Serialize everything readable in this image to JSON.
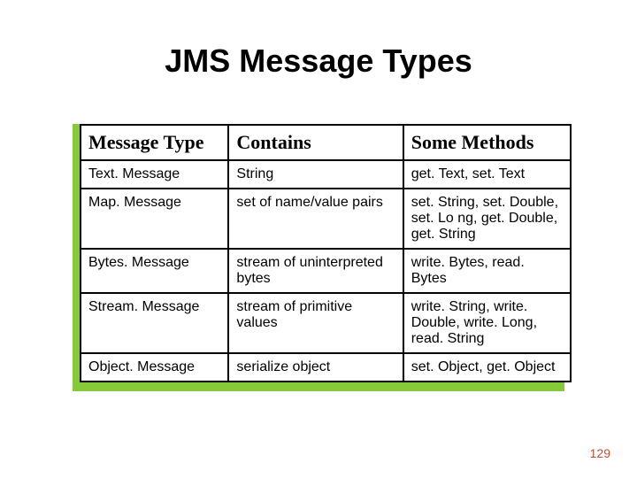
{
  "title": "JMS Message Types",
  "columns": [
    "Message Type",
    "Contains",
    "Some Methods"
  ],
  "rows": [
    {
      "type": "Text. Message",
      "contains": "String",
      "methods": "get. Text, set. Text"
    },
    {
      "type": "Map. Message",
      "contains": "set of name/value pairs",
      "methods": "set. String, set. Double, set. Lo ng, get. Double, get. String"
    },
    {
      "type": "Bytes. Message",
      "contains": "stream of uninterpreted bytes",
      "methods": "write. Bytes, read. Bytes"
    },
    {
      "type": "Stream. Message",
      "contains": "stream of primitive values",
      "methods": "write. String, write. Double, write. Long, read. String"
    },
    {
      "type": "Object. Message",
      "contains": "serialize object",
      "methods": "set. Object, get. Object"
    }
  ],
  "page_number": "129"
}
